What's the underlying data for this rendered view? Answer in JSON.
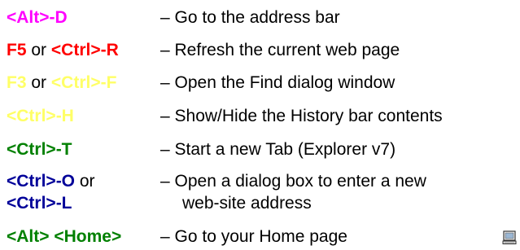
{
  "colors": {
    "magenta": "#ff00ff",
    "red": "#ff0000",
    "yellow": "#ffff66",
    "green": "#008000",
    "navy": "#000099",
    "text": "#000000"
  },
  "rows": [
    {
      "keys": [
        {
          "text": "<Alt>-D",
          "color": "magenta"
        }
      ],
      "desc": "– Go to the address bar"
    },
    {
      "keys": [
        {
          "text": "F5",
          "color": "red"
        },
        {
          "text": "or"
        },
        {
          "text": "<Ctrl>-R",
          "color": "red"
        }
      ],
      "desc": "– Refresh the current web page"
    },
    {
      "keys": [
        {
          "text": "F3",
          "color": "yellow"
        },
        {
          "text": "or"
        },
        {
          "text": "<Ctrl>-F",
          "color": "yellow"
        }
      ],
      "desc": "– Open the Find dialog window"
    },
    {
      "keys": [
        {
          "text": "<Ctrl>-H",
          "color": "yellow"
        }
      ],
      "desc": "– Show/Hide the History bar contents"
    },
    {
      "keys": [
        {
          "text": "<Ctrl>-T",
          "color": "green"
        }
      ],
      "desc": "– Start a new Tab (Explorer v7)"
    },
    {
      "keys": [
        {
          "text": "<Ctrl>-O",
          "color": "navy"
        },
        {
          "text": "or"
        }
      ],
      "desc": "– Open a dialog box to enter a new"
    },
    {
      "keys": [
        {
          "text": "<Ctrl>-L",
          "color": "navy"
        }
      ],
      "desc": "web-site address"
    },
    {
      "keys": [
        {
          "text": "<Alt> <Home>",
          "color": "green"
        }
      ],
      "desc": "– Go to your Home page"
    }
  ],
  "icons": {
    "corner": "computer-icon"
  }
}
